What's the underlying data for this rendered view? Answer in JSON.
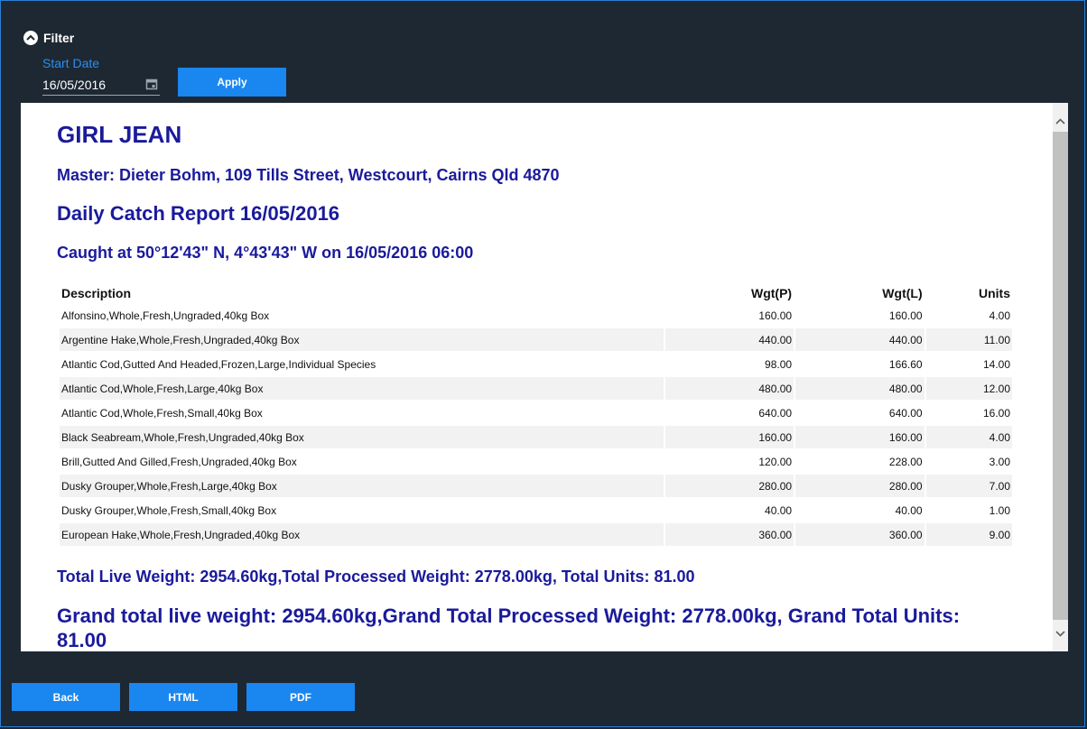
{
  "filter": {
    "toggle_label": "Filter",
    "start_date_label": "Start Date",
    "start_date_value": "16/05/2016",
    "apply_label": "Apply"
  },
  "report": {
    "vessel": "GIRL JEAN",
    "master": "Master: Dieter Bohm, 109 Tills Street, Westcourt, Cairns Qld 4870",
    "title": "Daily Catch Report 16/05/2016",
    "caught": "Caught at 50°12'43\" N, 4°43'43\" W on 16/05/2016 06:00",
    "columns": {
      "description": "Description",
      "wgt_p": "Wgt(P)",
      "wgt_l": "Wgt(L)",
      "units": "Units"
    },
    "rows": [
      {
        "description": "Alfonsino,Whole,Fresh,Ungraded,40kg Box",
        "wgt_p": "160.00",
        "wgt_l": "160.00",
        "units": "4.00"
      },
      {
        "description": "Argentine Hake,Whole,Fresh,Ungraded,40kg Box",
        "wgt_p": "440.00",
        "wgt_l": "440.00",
        "units": "11.00"
      },
      {
        "description": "Atlantic Cod,Gutted And Headed,Frozen,Large,Individual Species",
        "wgt_p": "98.00",
        "wgt_l": "166.60",
        "units": "14.00"
      },
      {
        "description": "Atlantic Cod,Whole,Fresh,Large,40kg Box",
        "wgt_p": "480.00",
        "wgt_l": "480.00",
        "units": "12.00"
      },
      {
        "description": "Atlantic Cod,Whole,Fresh,Small,40kg Box",
        "wgt_p": "640.00",
        "wgt_l": "640.00",
        "units": "16.00"
      },
      {
        "description": "Black Seabream,Whole,Fresh,Ungraded,40kg Box",
        "wgt_p": "160.00",
        "wgt_l": "160.00",
        "units": "4.00"
      },
      {
        "description": "Brill,Gutted And Gilled,Fresh,Ungraded,40kg Box",
        "wgt_p": "120.00",
        "wgt_l": "228.00",
        "units": "3.00"
      },
      {
        "description": "Dusky Grouper,Whole,Fresh,Large,40kg Box",
        "wgt_p": "280.00",
        "wgt_l": "280.00",
        "units": "7.00"
      },
      {
        "description": "Dusky Grouper,Whole,Fresh,Small,40kg Box",
        "wgt_p": "40.00",
        "wgt_l": "40.00",
        "units": "1.00"
      },
      {
        "description": "European Hake,Whole,Fresh,Ungraded,40kg Box",
        "wgt_p": "360.00",
        "wgt_l": "360.00",
        "units": "9.00"
      }
    ],
    "total_line": "Total Live Weight: 2954.60kg,Total Processed Weight: 2778.00kg, Total Units: 81.00",
    "grand_total_line": "Grand total live weight: 2954.60kg,Grand Total Processed Weight: 2778.00kg, Grand Total Units: 81.00"
  },
  "footer": {
    "back_label": "Back",
    "html_label": "HTML",
    "pdf_label": "PDF"
  },
  "colors": {
    "background": "#1d2833",
    "accent": "#1a86f0",
    "report_text": "#1a1a9c"
  }
}
